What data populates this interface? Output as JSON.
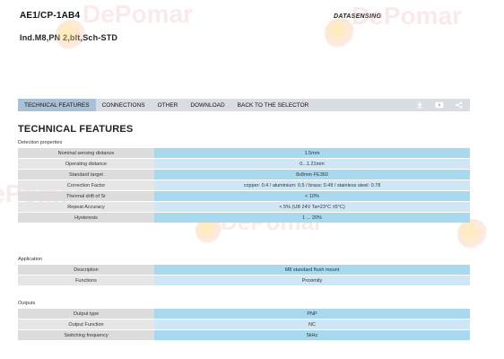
{
  "header": {
    "part_code": "AE1/CP-1AB4",
    "part_desc": "Ind.M8,PN      2,blt,Sch-STD",
    "brand": "DATASENSING"
  },
  "tabs": [
    {
      "label": "TECHNICAL FEATURES",
      "active": true
    },
    {
      "label": "CONNECTIONS",
      "active": false
    },
    {
      "label": "OTHER",
      "active": false
    },
    {
      "label": "DOWNLOAD",
      "active": false
    },
    {
      "label": "BACK TO THE SELECTOR",
      "active": false
    }
  ],
  "tab_icons": [
    "download-icon",
    "play-video-icon",
    "share-icon"
  ],
  "section_title": "TECHNICAL FEATURES",
  "groups": {
    "detection": {
      "label": "Detection properties",
      "rows": [
        {
          "k": "Nominal sensing distance",
          "v": "1.5mm"
        },
        {
          "k": "Operating distance",
          "v": "0...1.21mm"
        },
        {
          "k": "Standard target",
          "v": "8x8mm FE360"
        },
        {
          "k": "Correction Factor",
          "v": "copper: 0.4 / aluminium: 0.5 / brass: 0.49 / stainless steel: 0.78"
        },
        {
          "k": "Thermal drift of Sr",
          "v": "< 10%"
        },
        {
          "k": "Repeat Accuracy",
          "v": "< 5% (UB 24V Ta=23°C ±5°C)"
        },
        {
          "k": "Hysteresis",
          "v": "1 ... 20%"
        }
      ]
    },
    "application": {
      "label": "Application",
      "rows": [
        {
          "k": "Description",
          "v": "M8 standard flush mount"
        },
        {
          "k": "Functions",
          "v": "Proximity"
        }
      ]
    },
    "outputs": {
      "label": "Outputs",
      "rows": [
        {
          "k": "Output type",
          "v": "PNP"
        },
        {
          "k": "Output Function",
          "v": "NC"
        },
        {
          "k": "Switching frequency",
          "v": "5kHz"
        }
      ]
    }
  },
  "watermark_text": "DePomar"
}
